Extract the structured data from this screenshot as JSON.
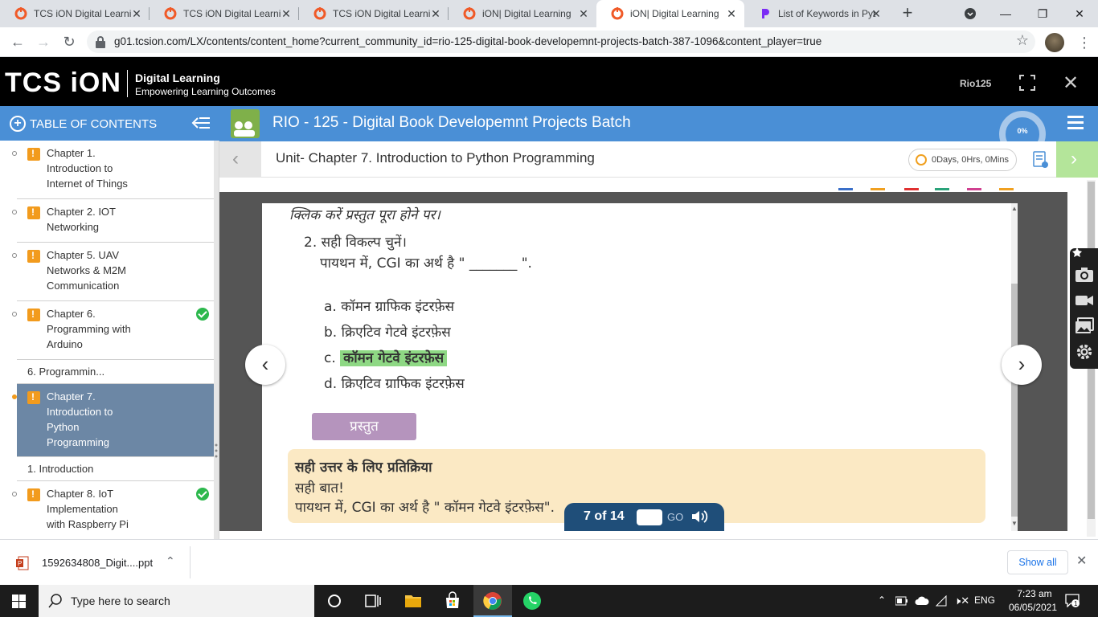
{
  "browser": {
    "tabs": [
      {
        "label": "TCS iON Digital Learning",
        "icon": "tcs-ion-favicon",
        "active": false
      },
      {
        "label": "TCS iON Digital Learning",
        "icon": "tcs-ion-favicon",
        "active": false
      },
      {
        "label": "TCS iON Digital Learning",
        "icon": "tcs-ion-favicon",
        "active": false
      },
      {
        "label": "iON| Digital Learning",
        "icon": "tcs-ion-favicon",
        "active": false
      },
      {
        "label": "iON| Digital Learning",
        "icon": "tcs-ion-favicon",
        "active": true
      },
      {
        "label": "List of Keywords in Python",
        "icon": "p-favicon",
        "active": false
      }
    ],
    "url": "g01.tcsion.com/LX/contents/content_home?current_community_id=rio-125-digital-book-developemnt-projects-batch-387-1096&content_player=true"
  },
  "app_header": {
    "logo_text": "TCS iON",
    "logo_title": "Digital Learning",
    "logo_tagline": "Empowering Learning Outcomes",
    "user": "Rio125"
  },
  "sidebar": {
    "header": "TABLE OF CONTENTS",
    "items": [
      {
        "label": "Chapter 1.\nIntroduction to\nInternet of Things",
        "done": false
      },
      {
        "label": "Chapter 2. IOT\nNetworking",
        "done": false
      },
      {
        "label": "Chapter 5. UAV\nNetworks & M2M\nCommunication",
        "done": false
      },
      {
        "label": "Chapter 6.\nProgramming with\nArduino",
        "done": true
      },
      {
        "label": "6. Programmin...",
        "done": false
      },
      {
        "label": "Chapter 7.\nIntroduction to\nPython\nProgramming",
        "done": false
      },
      {
        "label": "1. Introduction",
        "done": false
      },
      {
        "label": "Chapter 8. IoT\nImplementation\nwith Raspberry Pi",
        "done": true
      }
    ]
  },
  "course": {
    "title": "RIO - 125 - Digital Book Developemnt Projects Batch",
    "progress": "0%",
    "unit_title": "Unit- Chapter 7. Introduction to Python Programming",
    "timer": "0Days, 0Hrs, 0Mins"
  },
  "slide": {
    "top_instruction": "क्लिक करें प्रस्तुत पूरा होने पर।",
    "question_number": "2. सही विकल्प चुनें।",
    "question_text": "पायथन में, CGI का अर्थ है \" _______ \".",
    "options": [
      {
        "letter": "a.",
        "text": "कॉमन ग्राफिक इंटरफ़ेस",
        "correct": false
      },
      {
        "letter": "b.",
        "text": "क्रिएटिव गेटवे इंटरफ़ेस",
        "correct": false
      },
      {
        "letter": "c.",
        "text": "कॉमन गेटवे इंटरफ़ेस",
        "correct": true
      },
      {
        "letter": "d.",
        "text": "क्रिएटिव ग्राफिक इंटरफ़ेस",
        "correct": false
      }
    ],
    "submit_label": "प्रस्तुत",
    "feedback_title": "सही उत्तर के लिए प्रतिक्रिया",
    "feedback_line1": "सही बात!",
    "feedback_line2": "पायथन में, CGI का अर्थ है \" कॉमन गेटवे इंटरफ़ेस\"."
  },
  "pager": {
    "position": "7 of 14",
    "go_label": "GO"
  },
  "download": {
    "filename": "1592634808_Digit....ppt",
    "show_all": "Show all"
  },
  "taskbar": {
    "search_placeholder": "Type here to search",
    "language": "ENG",
    "time": "7:23 am",
    "date": "06/05/2021"
  },
  "colors": {
    "accent_blue": "#4a8fd6",
    "sidebar_active": "#6c87a5",
    "correct_highlight": "#8ed884",
    "feedback_bg": "#fbe9c4",
    "submit_btn": "#b594bd",
    "pager_bg": "#1f4e79"
  }
}
